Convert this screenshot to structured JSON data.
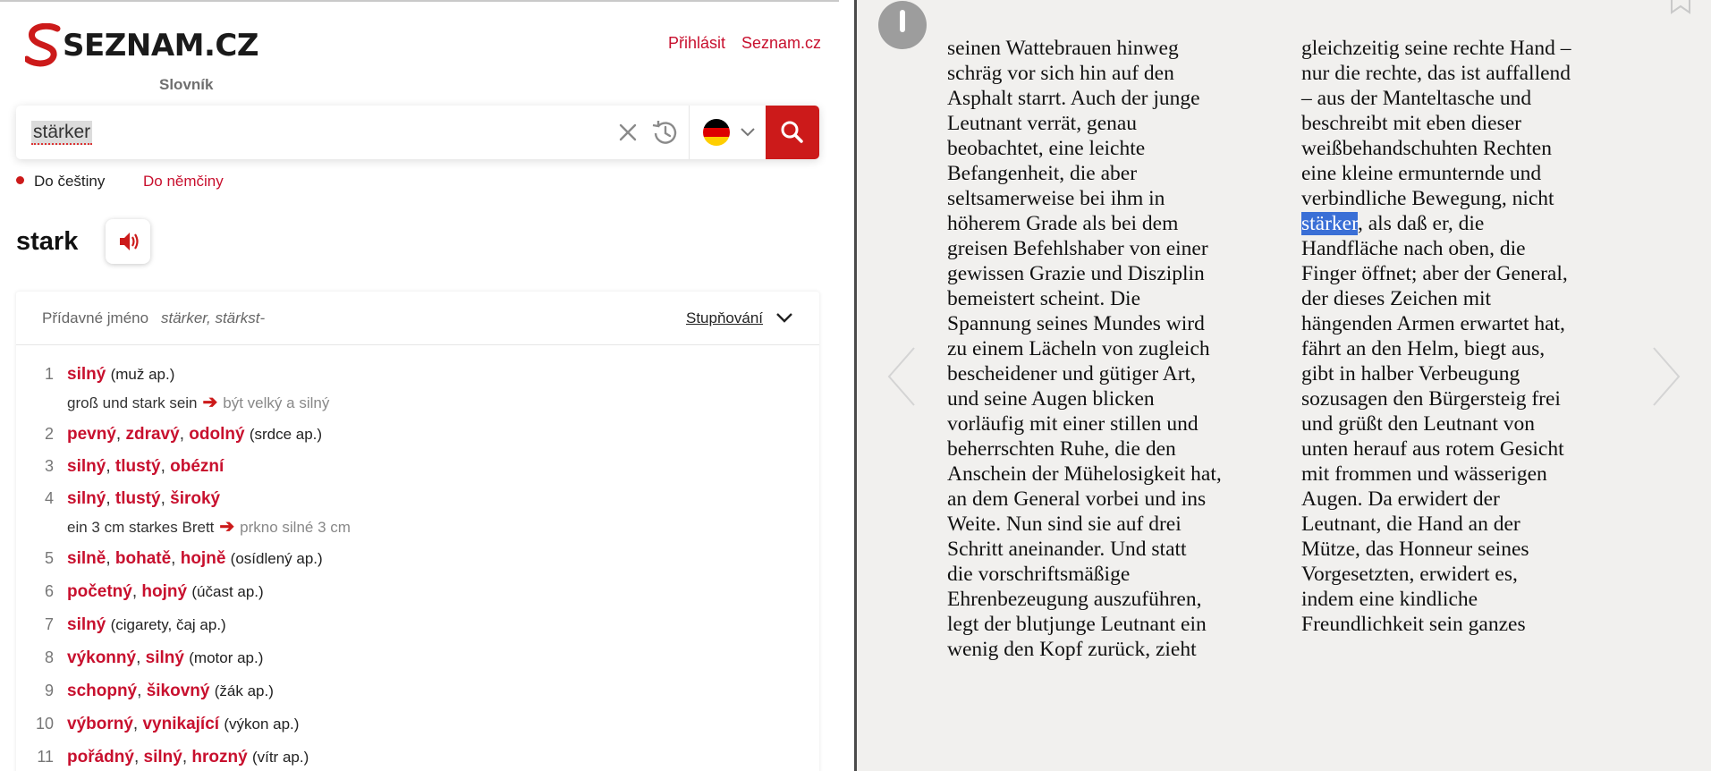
{
  "dictionary": {
    "logo": {
      "brand": "SEZNAM.CZ",
      "subtitle": "Slovník"
    },
    "header_links": {
      "login": "Přihlásit",
      "seznam": "Seznam.cz"
    },
    "search": {
      "value": "stärker",
      "language_flag": "german-flag-icon"
    },
    "direction": {
      "to_czech": "Do češtiny",
      "to_german": "Do němčiny",
      "selected": "to_czech"
    },
    "headword": "stark",
    "entry": {
      "part_of_speech": "Přídavné jméno",
      "forms": "stärker, stärkst-",
      "gradation_button": "Stupňování",
      "senses": [
        {
          "num": "1",
          "words": [
            "silný"
          ],
          "context": "(muž ap.)",
          "example": "groß und stark sein",
          "example_translation": "být velký a silný"
        },
        {
          "num": "2",
          "words": [
            "pevný",
            "zdravý",
            "odolný"
          ],
          "context": "(srdce ap.)"
        },
        {
          "num": "3",
          "words": [
            "silný",
            "tlustý",
            "obézní"
          ],
          "context": ""
        },
        {
          "num": "4",
          "words": [
            "silný",
            "tlustý",
            "široký"
          ],
          "context": "",
          "example": "ein 3 cm starkes Brett",
          "example_translation": "prkno silné 3 cm"
        },
        {
          "num": "5",
          "words": [
            "silně",
            "bohatě",
            "hojně"
          ],
          "context": "(osídlený ap.)"
        },
        {
          "num": "6",
          "words": [
            "početný",
            "hojný"
          ],
          "context": "(účast ap.)"
        },
        {
          "num": "7",
          "words": [
            "silný"
          ],
          "context": "(cigarety, čaj ap.)"
        },
        {
          "num": "8",
          "words": [
            "výkonný",
            "silný"
          ],
          "context": "(motor ap.)"
        },
        {
          "num": "9",
          "words": [
            "schopný",
            "šikovný"
          ],
          "context": "(žák ap.)"
        },
        {
          "num": "10",
          "words": [
            "výborný",
            "vynikající"
          ],
          "context": "(výkon ap.)"
        },
        {
          "num": "11",
          "words": [
            "pořádný",
            "silný",
            "hrozný"
          ],
          "context": "(vítr ap.)"
        }
      ]
    }
  },
  "reader": {
    "selected_word": "stärker",
    "column1": [
      "seinen Wattebrauen hinweg",
      "schräg vor sich hin auf den",
      "Asphalt starrt. Auch der junge",
      "Leutnant verrät, genau",
      "beobachtet, eine leichte",
      "Befangenheit, die aber",
      "seltsamerweise bei ihm in",
      "höherem Grade als bei dem",
      "greisen Befehlshaber von einer",
      "gewissen Grazie und Disziplin",
      "bemeistert scheint. Die",
      "Spannung seines Mundes wird",
      "zu einem Lächeln von zugleich",
      "bescheidener und gütiger Art,",
      "und seine Augen blicken",
      "vorläufig mit einer stillen und",
      "beherrschten Ruhe, die den",
      "Anschein der Mühelosigkeit hat,",
      "an dem General vorbei und ins",
      "Weite. Nun sind sie auf drei",
      "Schritt aneinander. Und statt",
      "die vorschriftsmäßige",
      "Ehrenbezeugung auszuführen,",
      "legt der blutjunge Leutnant ein",
      "wenig den Kopf zurück, zieht"
    ],
    "column2_before": [
      "gleichzeitig seine rechte Hand –",
      "nur die rechte, das ist auffallend",
      "– aus der Manteltasche und",
      "beschreibt mit eben dieser",
      "weißbehandschuhten Rechten",
      "eine kleine ermunternde und",
      "verbindliche Bewegung, nicht"
    ],
    "column2_selected_rest": ", als daß er, die",
    "column2_after": [
      "Handfläche nach oben, die",
      "Finger öffnet; aber der General,",
      "der dieses Zeichen mit",
      "hängenden Armen erwartet hat,",
      "fährt an den Helm, biegt aus,",
      "gibt in halber Verbeugung",
      "sozusagen den Bürgersteig frei",
      "und grüßt den Leutnant von",
      "unten herauf aus rotem Gesicht",
      "mit frommen und wässerigen",
      "Augen. Da erwidert der",
      "Leutnant, die Hand an der",
      "Mütze, das Honneur seines",
      "Vorgesetzten, erwidert es,",
      "indem eine kindliche",
      "Freundlichkeit sein ganzes"
    ]
  },
  "colors": {
    "accent_red": "#c8102e",
    "search_button": "#cc1a1a",
    "selection": "#3a6fd6",
    "reader_bg": "#f1f0ee"
  }
}
